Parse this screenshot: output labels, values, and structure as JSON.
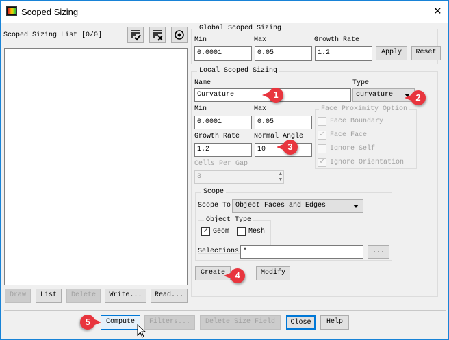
{
  "window": {
    "title": "Scoped Sizing",
    "close": "✕"
  },
  "list": {
    "title": "Scoped Sizing List [0/0]",
    "buttons": {
      "draw": "Draw",
      "list": "List",
      "delete": "Delete",
      "write": "Write...",
      "read": "Read..."
    }
  },
  "global": {
    "title": "Global Scoped Sizing",
    "min_label": "Min",
    "min": "0.0001",
    "max_label": "Max",
    "max": "0.05",
    "growth_label": "Growth Rate",
    "growth": "1.2",
    "apply": "Apply",
    "reset": "Reset"
  },
  "local": {
    "title": "Local Scoped Sizing",
    "name_label": "Name",
    "name": "Curvature",
    "type_label": "Type",
    "type": "curvature",
    "min_label": "Min",
    "min": "0.0001",
    "max_label": "Max",
    "max": "0.05",
    "growth_label": "Growth Rate",
    "growth": "1.2",
    "angle_label": "Normal Angle",
    "angle": "10",
    "cells_label": "Cells Per Gap",
    "cells": "3",
    "proximity": {
      "title": "Face Proximity Option",
      "options": [
        {
          "label": "Face Boundary",
          "checked": false
        },
        {
          "label": "Face Face",
          "checked": true
        },
        {
          "label": "Ignore Self",
          "checked": false
        },
        {
          "label": "Ignore Orientation",
          "checked": true
        }
      ]
    },
    "scope": {
      "title": "Scope",
      "scope_to_label": "Scope To",
      "scope_to": "Object Faces and Edges",
      "object_type_title": "Object Type",
      "geom": "Geom",
      "geom_checked": true,
      "mesh": "Mesh",
      "mesh_checked": false,
      "selections_label": "Selections",
      "selections": "*",
      "browse": "..."
    },
    "create": "Create",
    "modify": "Modify"
  },
  "footer": {
    "compute": "Compute",
    "filters": "Filters...",
    "delete_field": "Delete Size Field",
    "close": "Close",
    "help": "Help"
  },
  "markers": [
    "1",
    "2",
    "3",
    "4",
    "5"
  ],
  "colors": {
    "marker": "#e8353e",
    "accent": "#0078d7"
  }
}
